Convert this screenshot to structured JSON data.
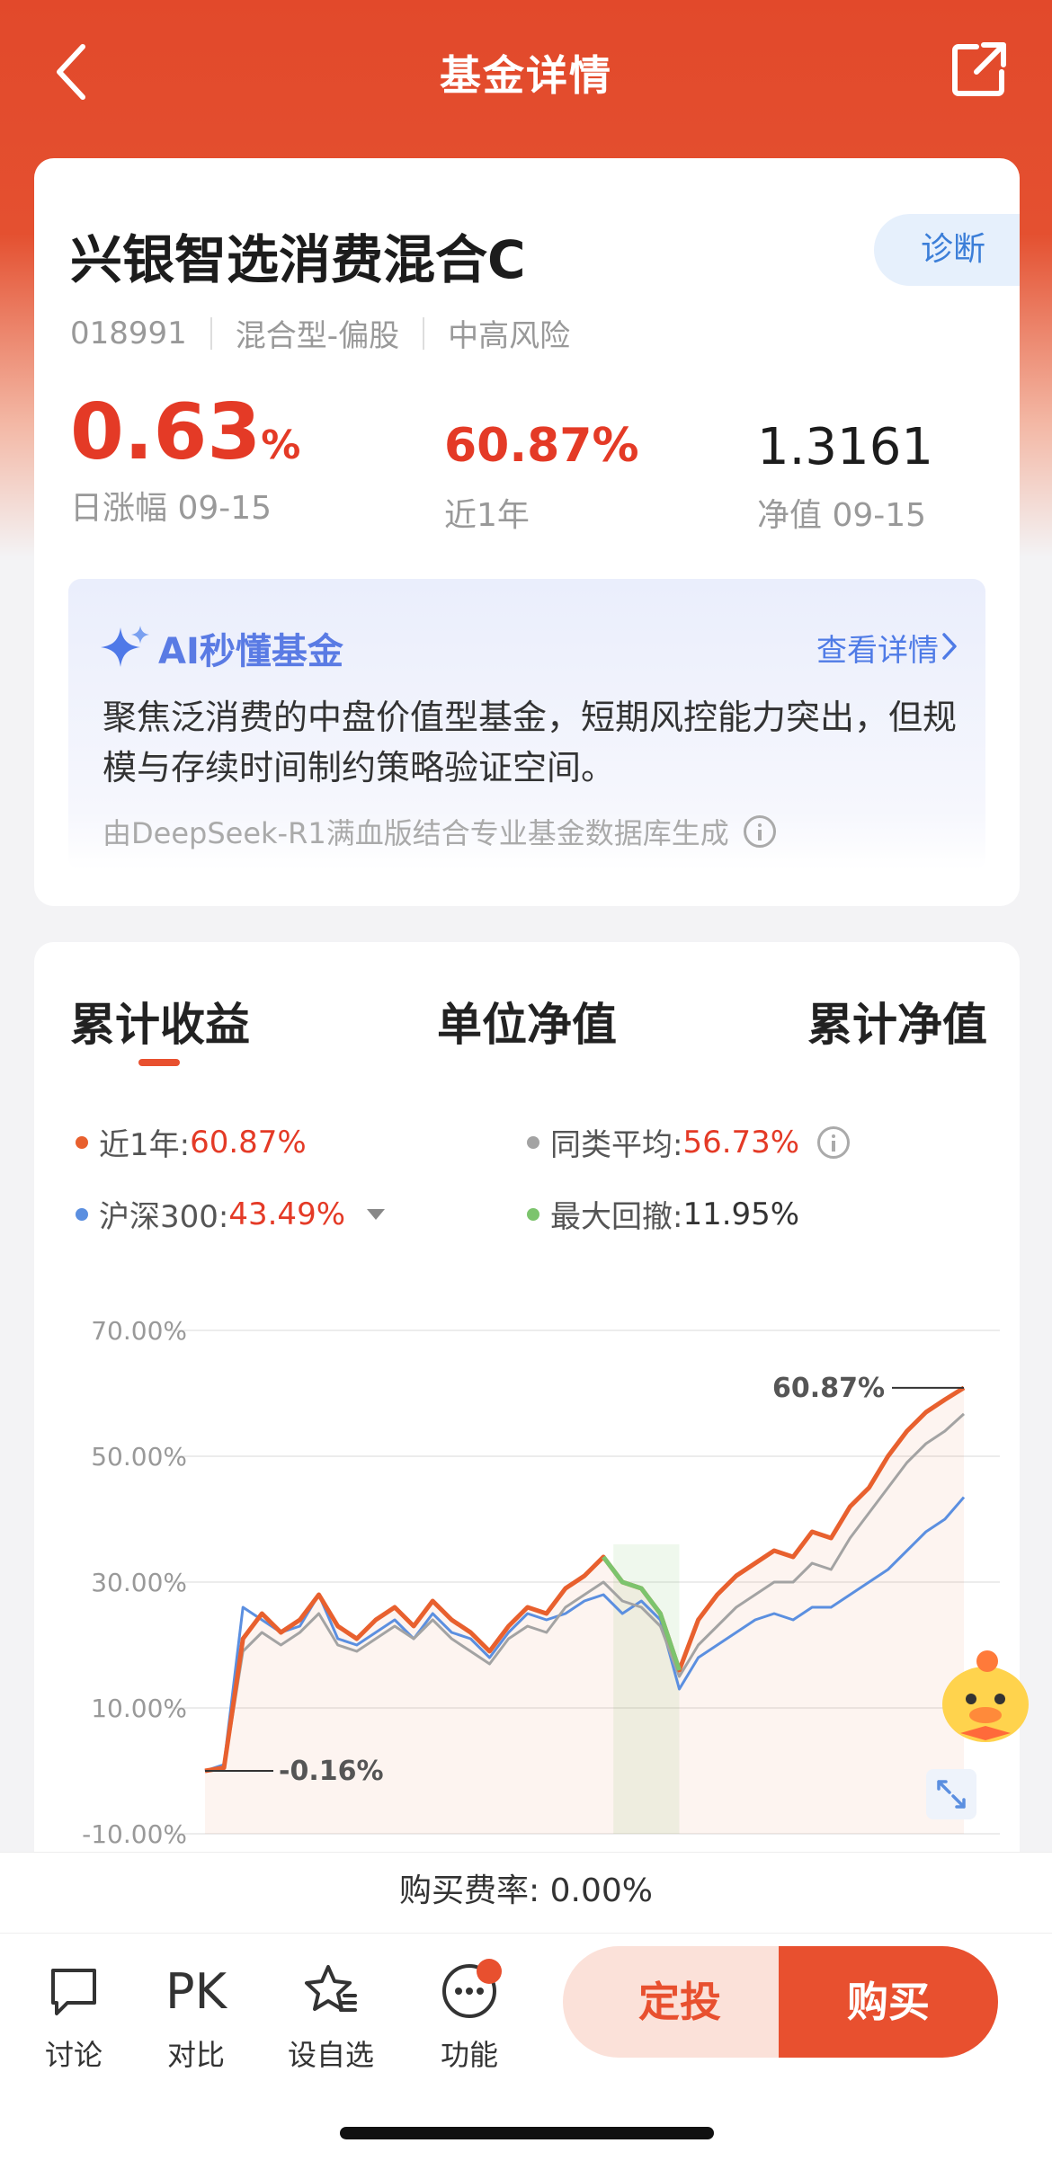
{
  "nav": {
    "title": "基金详情"
  },
  "fund": {
    "name": "兴银智选消费混合C",
    "diagnose": "诊断",
    "code": "018991",
    "type": "混合型-偏股",
    "risk": "中高风险",
    "daily_change": "0.63",
    "daily_change_unit": "%",
    "daily_change_label": "日涨幅 09-15",
    "year_return": "60.87%",
    "year_return_label": "近1年",
    "nav_value": "1.3161",
    "nav_label": "净值 09-15"
  },
  "ai": {
    "title": "AI秒懂基金",
    "more": "查看详情",
    "summary": "聚焦泛消费的中盘价值型基金，短期风控能力突出，但规模与存续时间制约策略验证空间。",
    "source": "由DeepSeek-R1满血版结合专业基金数据库生成"
  },
  "tabs": [
    "累计收益",
    "单位净值",
    "累计净值"
  ],
  "legend": {
    "fund_label": "近1年:",
    "fund_value": "60.87%",
    "peer_label": "同类平均:",
    "peer_value": "56.73%",
    "index_label": "沪深300:",
    "index_value": "43.49%",
    "drawdown_label": "最大回撤:",
    "drawdown_value": "11.95%"
  },
  "colors": {
    "fund": "#e8602e",
    "peer": "#a3a3a3",
    "index": "#5b8fe0",
    "drawdown": "#7cc46d",
    "accent": "#e8502f"
  },
  "chart_data": {
    "type": "line",
    "yticks": [
      "70.00%",
      "50.00%",
      "30.00%",
      "10.00%",
      "-10.00%"
    ],
    "ylim": [
      -10,
      70
    ],
    "grid": true,
    "x": [
      0,
      1,
      2,
      3,
      4,
      5,
      6,
      7,
      8,
      9,
      10,
      11,
      12,
      13,
      14,
      15,
      16,
      17,
      18,
      19,
      20,
      21,
      22,
      23,
      24,
      25,
      26,
      27,
      28,
      29,
      30,
      31,
      32,
      33,
      34,
      35,
      36,
      37,
      38,
      39,
      40
    ],
    "series": [
      {
        "name": "近1年",
        "values": [
          0,
          0.5,
          21,
          25,
          22,
          24,
          28,
          23,
          21,
          24,
          26,
          23,
          27,
          24,
          22,
          19,
          23,
          26,
          25,
          29,
          31,
          34,
          30,
          29,
          25,
          16,
          24,
          28,
          31,
          33,
          35,
          34,
          38,
          37,
          42,
          45,
          50,
          54,
          57,
          59,
          60.87
        ]
      },
      {
        "name": "同类平均",
        "values": [
          0,
          0.3,
          19,
          22,
          20,
          22,
          25,
          20,
          19,
          21,
          23,
          21,
          24,
          21,
          19,
          17,
          21,
          23,
          22,
          26,
          28,
          30,
          27,
          26,
          23,
          15,
          20,
          23,
          26,
          28,
          30,
          30,
          33,
          32,
          37,
          41,
          45,
          49,
          52,
          54,
          56.73
        ]
      },
      {
        "name": "沪深300",
        "values": [
          0,
          1,
          26,
          24,
          22,
          23,
          28,
          21,
          20,
          22,
          24,
          21,
          25,
          22,
          21,
          18,
          22,
          25,
          24,
          25,
          27,
          28,
          25,
          27,
          24,
          13,
          18,
          20,
          22,
          24,
          25,
          24,
          26,
          26,
          28,
          30,
          32,
          35,
          38,
          40,
          43.49
        ]
      }
    ],
    "drawdown_range": [
      21,
      25
    ],
    "annotations": [
      "60.87%",
      "-0.16%"
    ]
  },
  "fee": "购买费率: 0.00%",
  "bottom": {
    "discuss": "讨论",
    "compare_icon": "PK",
    "compare": "对比",
    "watch": "设自选",
    "func": "功能",
    "plan": "定投",
    "buy": "购买"
  }
}
